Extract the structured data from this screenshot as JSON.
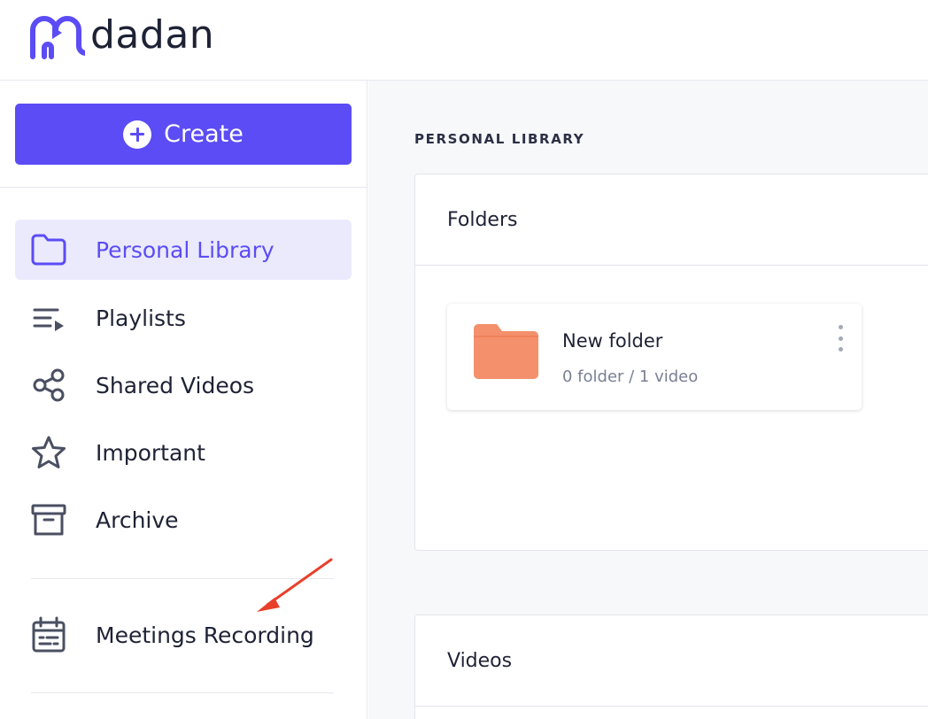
{
  "app": {
    "logo_text": "dadan",
    "brand_color": "#5b4cf5",
    "logo_icon": "elephant-play-icon"
  },
  "sidebar": {
    "create_label": "Create",
    "create_icon": "plus-circle-icon",
    "items": [
      {
        "label": "Personal Library",
        "icon": "folder-icon",
        "active": true
      },
      {
        "label": "Playlists",
        "icon": "playlist-icon",
        "active": false
      },
      {
        "label": "Shared Videos",
        "icon": "share-icon",
        "active": false
      },
      {
        "label": "Important",
        "icon": "star-icon",
        "active": false
      },
      {
        "label": "Archive",
        "icon": "archive-icon",
        "active": false
      },
      {
        "label": "Meetings Recording",
        "icon": "calendar-icon",
        "active": false
      }
    ]
  },
  "annotation": {
    "arrow_color": "#e8402a",
    "points_to": "Meetings Recording"
  },
  "main": {
    "section_title": "PERSONAL LIBRARY",
    "folders_panel": {
      "title": "Folders",
      "folders": [
        {
          "name": "New folder",
          "meta": "0 folder / 1 video",
          "color": "#f4906b"
        }
      ]
    },
    "videos_panel": {
      "title": "Videos"
    }
  }
}
